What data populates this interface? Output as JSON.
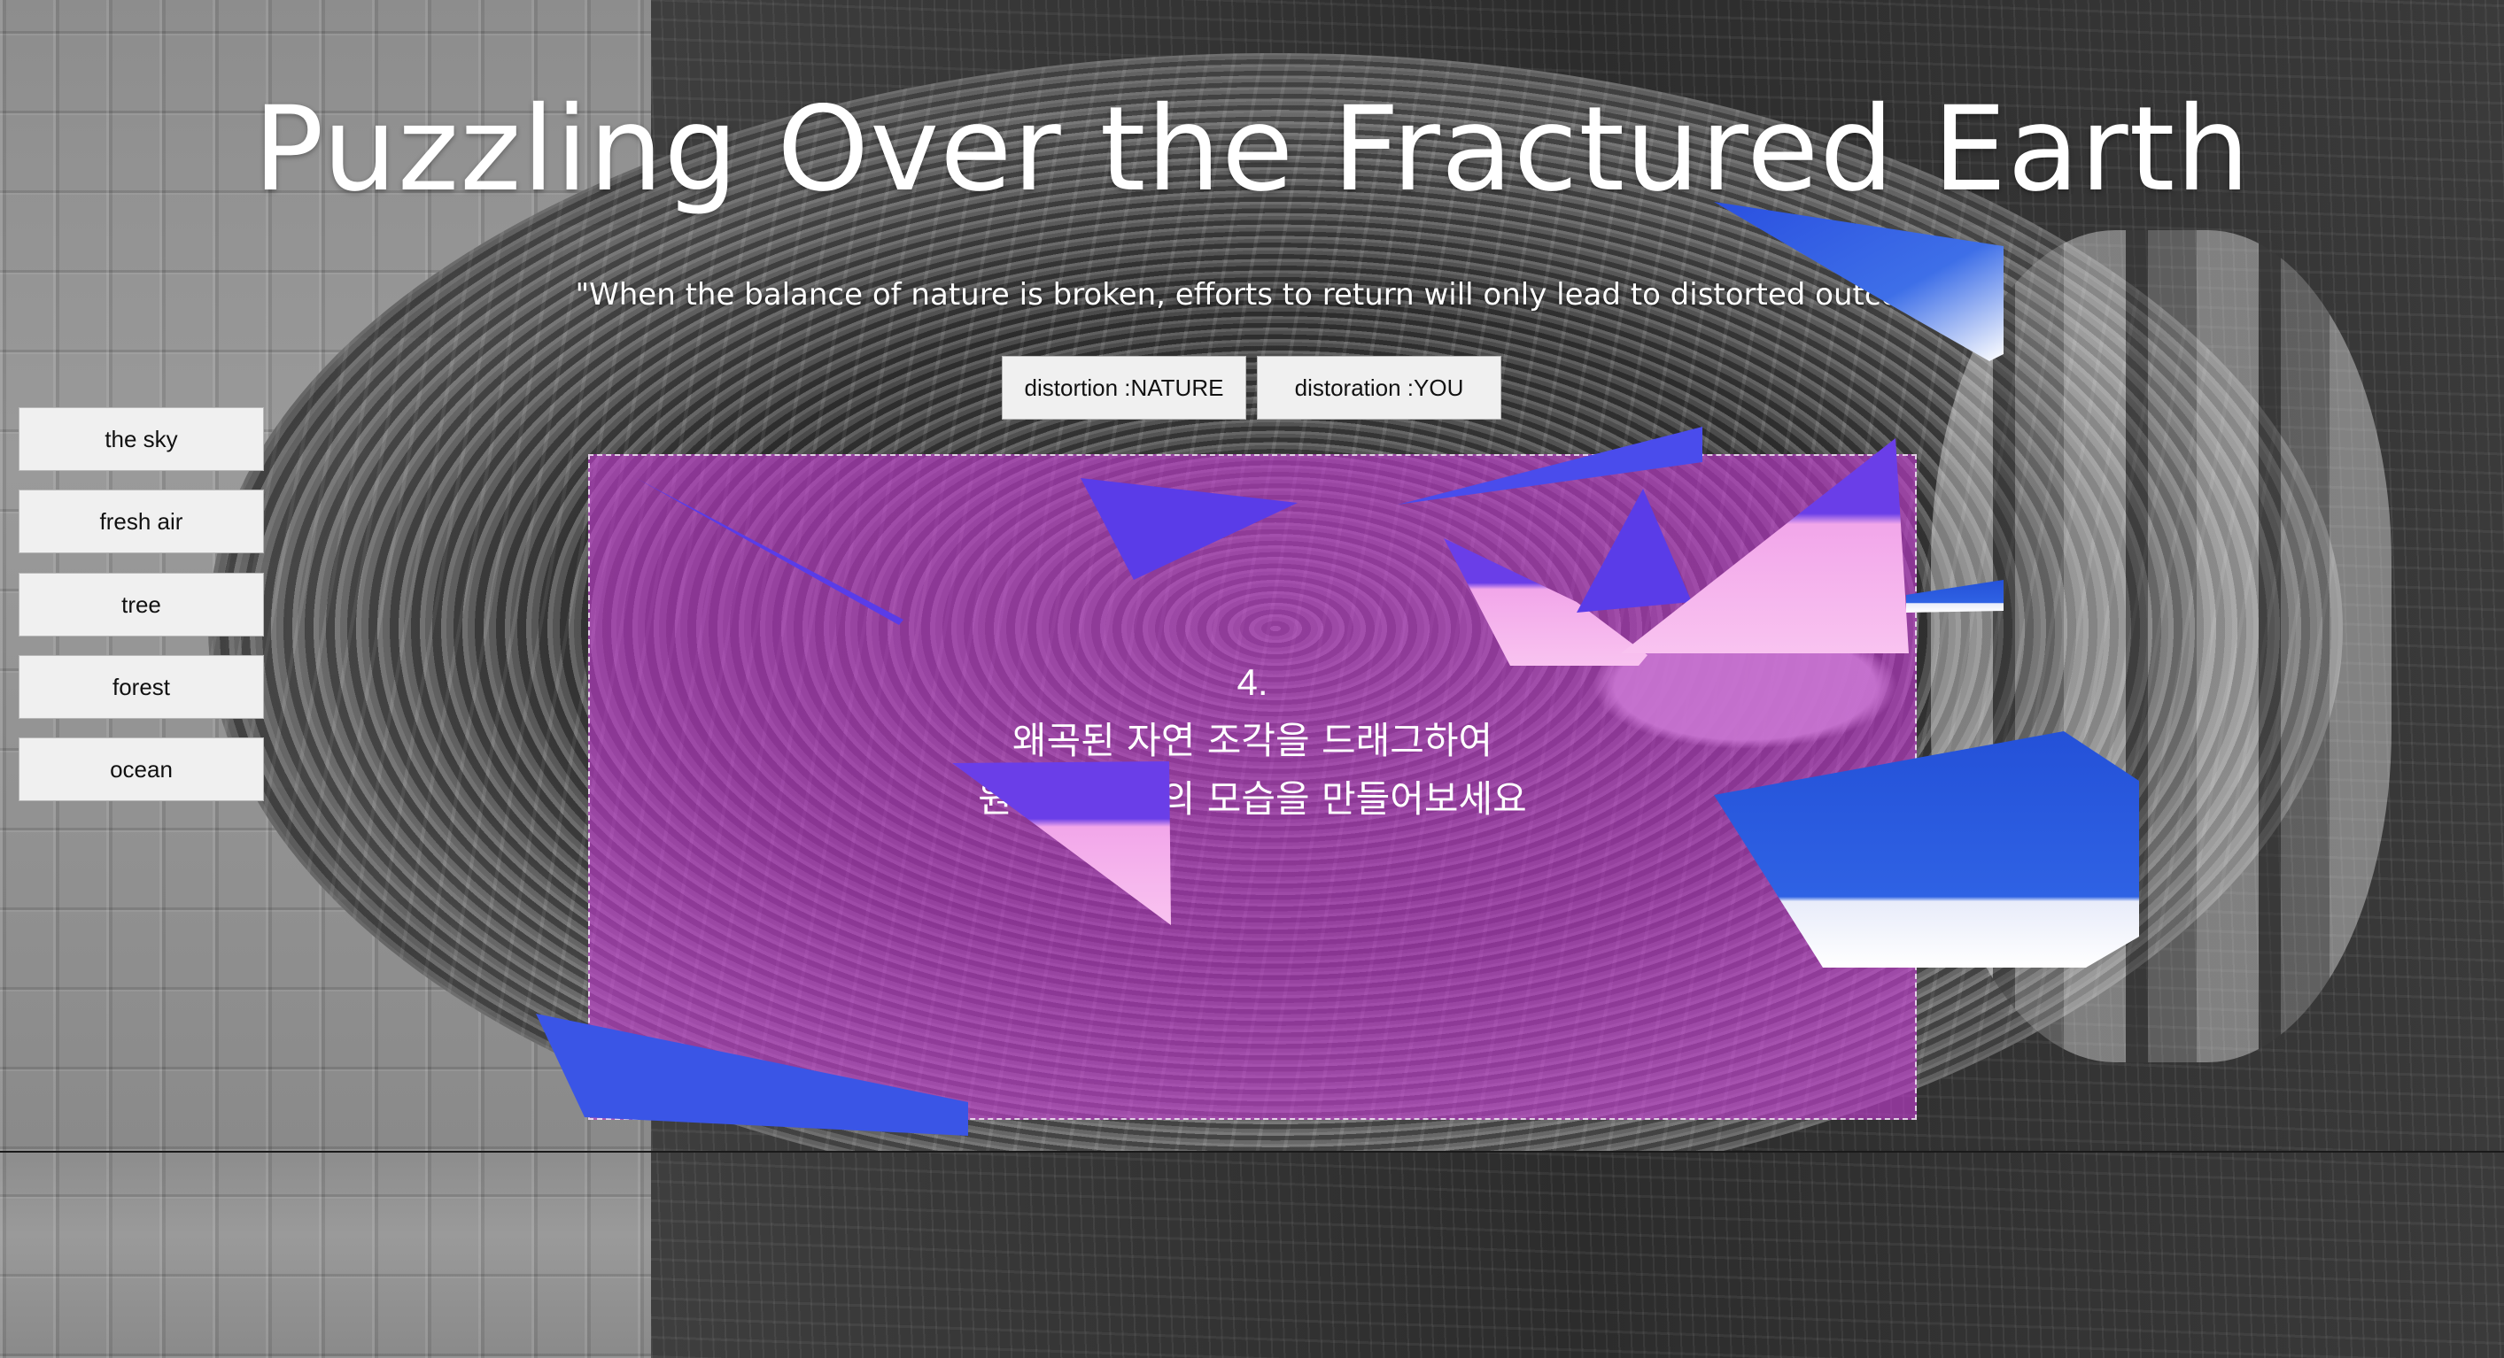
{
  "title": "Puzzling Over the Fractured Earth",
  "quote": "\"When the balance of nature is broken, efforts to return will only lead to distorted outcom",
  "mode_buttons": {
    "nature": "distortion :NATURE",
    "you": "distoration :YOU"
  },
  "side_buttons": [
    "the sky",
    "fresh air",
    "tree",
    "forest",
    "ocean"
  ],
  "instruction": {
    "number": "4.",
    "line1": "왜곡된 자연 조각을 드래그하여",
    "line2": "원래의 자연의 모습을 만들어보세요"
  },
  "colors": {
    "puzzle_overlay": "#c43cd2",
    "shard_blue": "#2a50e0",
    "shard_violet": "#5a3ce8",
    "shard_pink": "#f5a8e8"
  }
}
